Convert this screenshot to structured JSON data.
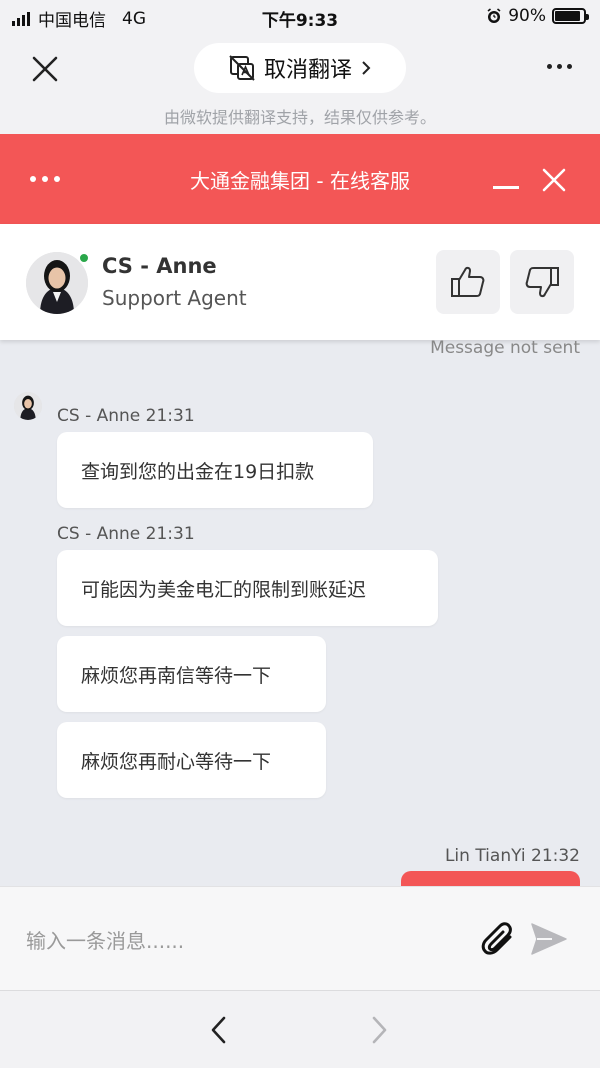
{
  "status_bar": {
    "carrier": "中国电信",
    "network": "4G",
    "time": "下午9:33",
    "battery": "90%",
    "battery_level": 0.9
  },
  "browser": {
    "translate_button": "取消翻译",
    "translate_note": "由微软提供翻译支持，结果仅供参考。"
  },
  "chat_window": {
    "title": "大通金融集团 - 在线客服"
  },
  "agent": {
    "name": "CS - Anne",
    "role": "Support Agent"
  },
  "messages": {
    "status_note": "Message not sent",
    "groups": [
      {
        "meta": "CS - Anne 21:31",
        "bubbles": [
          "查询到您的出金在19日扣款"
        ]
      },
      {
        "meta": "CS - Anne 21:31",
        "bubbles": [
          "可能因为美金电汇的限制到账延迟",
          "麻烦您再南信等待一下",
          "麻烦您再耐心等待一下"
        ]
      }
    ],
    "user_meta": "Lin TianYi 21:32"
  },
  "input": {
    "placeholder": "输入一条消息......"
  },
  "colors": {
    "accent": "#f35656",
    "online": "#2aa74a",
    "background": "#e9ebf0"
  }
}
